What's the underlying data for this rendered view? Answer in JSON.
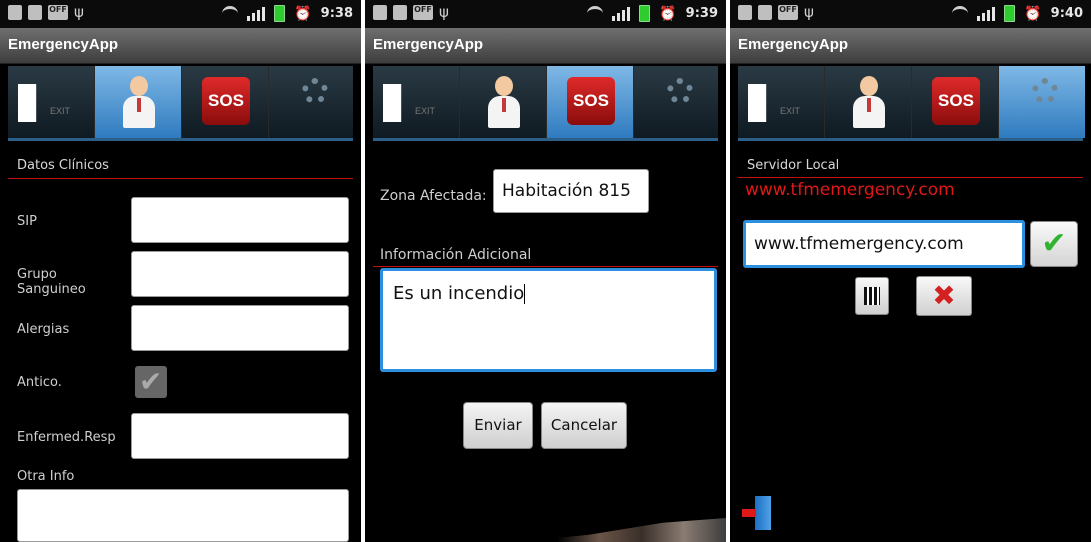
{
  "statusbar": {
    "off_badge": "OFF",
    "times": [
      "9:38",
      "9:39",
      "9:40"
    ]
  },
  "app_title": "EmergencyApp",
  "tabs": {
    "exit_label": "EXIT",
    "sos_label": "SOS"
  },
  "screen1": {
    "section_header": "Datos Clínicos",
    "fields": {
      "sip": "SIP",
      "grupo": "Grupo Sanguineo",
      "alergias": "Alergias",
      "antico": "Antico.",
      "enfermed": "Enfermed.Resp",
      "otra_info": "Otra Info"
    },
    "antico_checked": true
  },
  "screen2": {
    "zona_label": "Zona Afectada:",
    "zona_value": "Habitación 815",
    "info_label": "Información Adicional",
    "info_value": "Es un incendio",
    "send_button": "Enviar",
    "cancel_button": "Cancelar"
  },
  "screen3": {
    "section_header": "Servidor Local",
    "current_server": "www.tfmemergency.com",
    "server_input_value": "www.tfmemergency.com"
  },
  "colors": {
    "accent_red": "#e01818",
    "focus_blue": "#2d8fe0",
    "selected_tab": "#2f7bbf"
  }
}
